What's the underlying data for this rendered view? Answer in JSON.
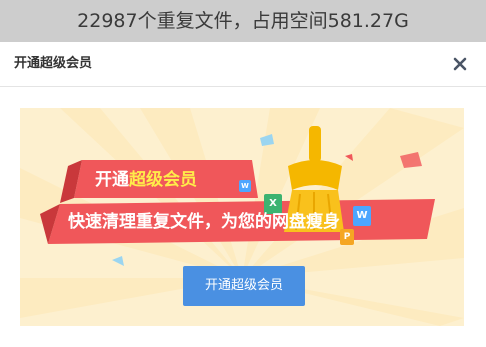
{
  "background": {
    "stats_text": "22987个重复文件，占用空间581.27G"
  },
  "modal": {
    "title": "开通超级会员",
    "close_icon": "close-icon"
  },
  "banner": {
    "line1_prefix": "开通",
    "line1_highlight": "超级会员",
    "line2": "快速清理重复文件，为您的网盘瘦身",
    "cta_label": "开通超级会员",
    "icons": {
      "x": "X",
      "w": "W",
      "p": "P",
      "w_small": "W"
    }
  },
  "colors": {
    "accent_blue": "#4a90e2",
    "ribbon_red": "#f0575a",
    "highlight_yellow": "#ffec4a",
    "banner_bg": "#fdf0cf",
    "broom_gold": "#f5b700"
  }
}
